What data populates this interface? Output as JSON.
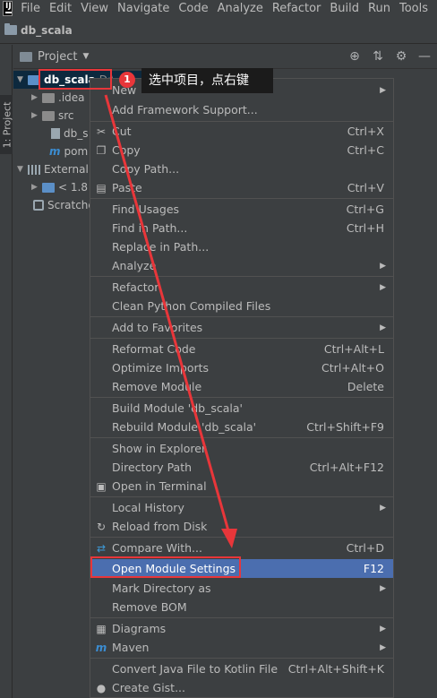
{
  "menubar": {
    "logo": "IJ",
    "items": [
      "File",
      "Edit",
      "View",
      "Navigate",
      "Code",
      "Analyze",
      "Refactor",
      "Build",
      "Run",
      "Tools"
    ]
  },
  "navbar": {
    "crumb": "db_scala"
  },
  "stripe": {
    "tab": "1: Project"
  },
  "panel": {
    "title": "Project",
    "tools": [
      "target-icon",
      "collapse-icon",
      "gear-icon",
      "minimize-icon"
    ]
  },
  "tree": {
    "root": "db_scala",
    "root_path": "D:\\...",
    "items": [
      ".idea",
      "src",
      "db_s",
      "pom",
      "External",
      "< 1.8",
      "Scratche"
    ]
  },
  "callout": {
    "badge": "1",
    "text": "选中项目，点右键"
  },
  "menu": {
    "items": [
      {
        "label": "New",
        "shortcut": "",
        "submenu": true
      },
      {
        "label": "Add Framework Support...",
        "shortcut": ""
      },
      {
        "label": "Cut",
        "shortcut": "Ctrl+X"
      },
      {
        "label": "Copy",
        "shortcut": "Ctrl+C"
      },
      {
        "label": "Copy Path...",
        "shortcut": ""
      },
      {
        "label": "Paste",
        "shortcut": "Ctrl+V"
      },
      {
        "label": "Find Usages",
        "shortcut": "Ctrl+G"
      },
      {
        "label": "Find in Path...",
        "shortcut": "Ctrl+H"
      },
      {
        "label": "Replace in Path...",
        "shortcut": ""
      },
      {
        "label": "Analyze",
        "shortcut": "",
        "submenu": true
      },
      {
        "label": "Refactor",
        "shortcut": "",
        "submenu": true
      },
      {
        "label": "Clean Python Compiled Files",
        "shortcut": ""
      },
      {
        "label": "Add to Favorites",
        "shortcut": "",
        "submenu": true
      },
      {
        "label": "Reformat Code",
        "shortcut": "Ctrl+Alt+L"
      },
      {
        "label": "Optimize Imports",
        "shortcut": "Ctrl+Alt+O"
      },
      {
        "label": "Remove Module",
        "shortcut": "Delete"
      },
      {
        "label": "Build Module 'db_scala'",
        "shortcut": ""
      },
      {
        "label": "Rebuild Module 'db_scala'",
        "shortcut": "Ctrl+Shift+F9"
      },
      {
        "label": "Show in Explorer",
        "shortcut": ""
      },
      {
        "label": "Directory Path",
        "shortcut": "Ctrl+Alt+F12"
      },
      {
        "label": "Open in Terminal",
        "shortcut": ""
      },
      {
        "label": "Local History",
        "shortcut": "",
        "submenu": true
      },
      {
        "label": "Reload from Disk",
        "shortcut": ""
      },
      {
        "label": "Compare With...",
        "shortcut": "Ctrl+D"
      },
      {
        "label": "Open Module Settings",
        "shortcut": "F12"
      },
      {
        "label": "Mark Directory as",
        "shortcut": "",
        "submenu": true
      },
      {
        "label": "Remove BOM",
        "shortcut": ""
      },
      {
        "label": "Diagrams",
        "shortcut": "",
        "submenu": true
      },
      {
        "label": "Maven",
        "shortcut": "",
        "submenu": true
      },
      {
        "label": "Convert Java File to Kotlin File",
        "shortcut": "Ctrl+Alt+Shift+K"
      },
      {
        "label": "Create Gist...",
        "shortcut": ""
      }
    ]
  },
  "colors": {
    "background": "#3c3f41",
    "highlight": "#4b6eaf",
    "annotation": "#e8363a"
  }
}
